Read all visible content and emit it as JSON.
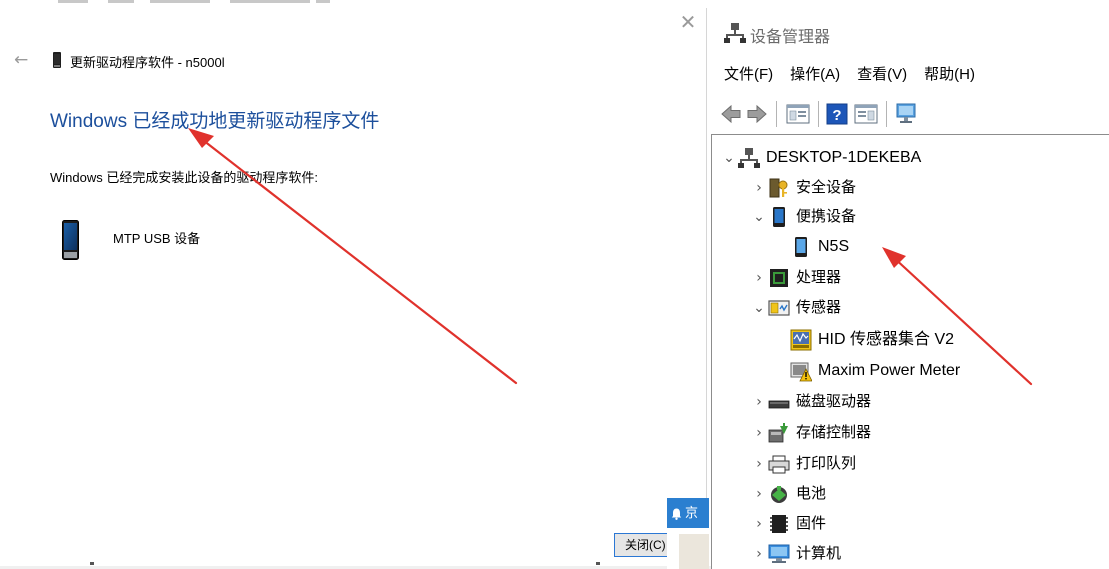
{
  "wizard": {
    "window_title": "更新驱动程序软件 - n5000l",
    "heading": "Windows 已经成功地更新驱动程序文件",
    "description": "Windows 已经完成安装此设备的驱动程序软件:",
    "device_name": "MTP USB 设备",
    "close_button": "关闭(C)",
    "popup_label": "京",
    "icons": {
      "back": "back-arrow-icon",
      "close": "close-icon",
      "device": "mobile-device-icon"
    }
  },
  "device_manager": {
    "title": "设备管理器",
    "menu": [
      "文件(F)",
      "操作(A)",
      "查看(V)",
      "帮助(H)"
    ],
    "toolbar": [
      "back-icon",
      "forward-icon",
      "properties-icon",
      "help-icon",
      "details-icon",
      "monitor-icon"
    ],
    "tree": {
      "root": "DESKTOP-1DEKEBA",
      "items": [
        {
          "label": "安全设备",
          "expanded": false,
          "icon": "security-key-icon"
        },
        {
          "label": "便携设备",
          "expanded": true,
          "icon": "portable-device-icon",
          "children": [
            {
              "label": "N5S",
              "icon": "portable-device-icon"
            }
          ]
        },
        {
          "label": "处理器",
          "expanded": false,
          "icon": "processor-icon"
        },
        {
          "label": "传感器",
          "expanded": true,
          "icon": "sensor-icon",
          "children": [
            {
              "label": "HID 传感器集合 V2",
              "icon": "sensor-collection-icon"
            },
            {
              "label": "Maxim Power Meter",
              "icon": "warning-sensor-icon"
            }
          ]
        },
        {
          "label": "磁盘驱动器",
          "expanded": false,
          "icon": "disk-drive-icon"
        },
        {
          "label": "存储控制器",
          "expanded": false,
          "icon": "storage-controller-icon"
        },
        {
          "label": "打印队列",
          "expanded": false,
          "icon": "printer-icon"
        },
        {
          "label": "电池",
          "expanded": false,
          "icon": "battery-icon"
        },
        {
          "label": "固件",
          "expanded": false,
          "icon": "firmware-icon"
        },
        {
          "label": "计算机",
          "expanded": false,
          "icon": "computer-icon"
        }
      ]
    }
  },
  "colors": {
    "heading_blue": "#1c4f9c",
    "annotation_red": "#e0322c",
    "button_border": "#2b77d4"
  }
}
